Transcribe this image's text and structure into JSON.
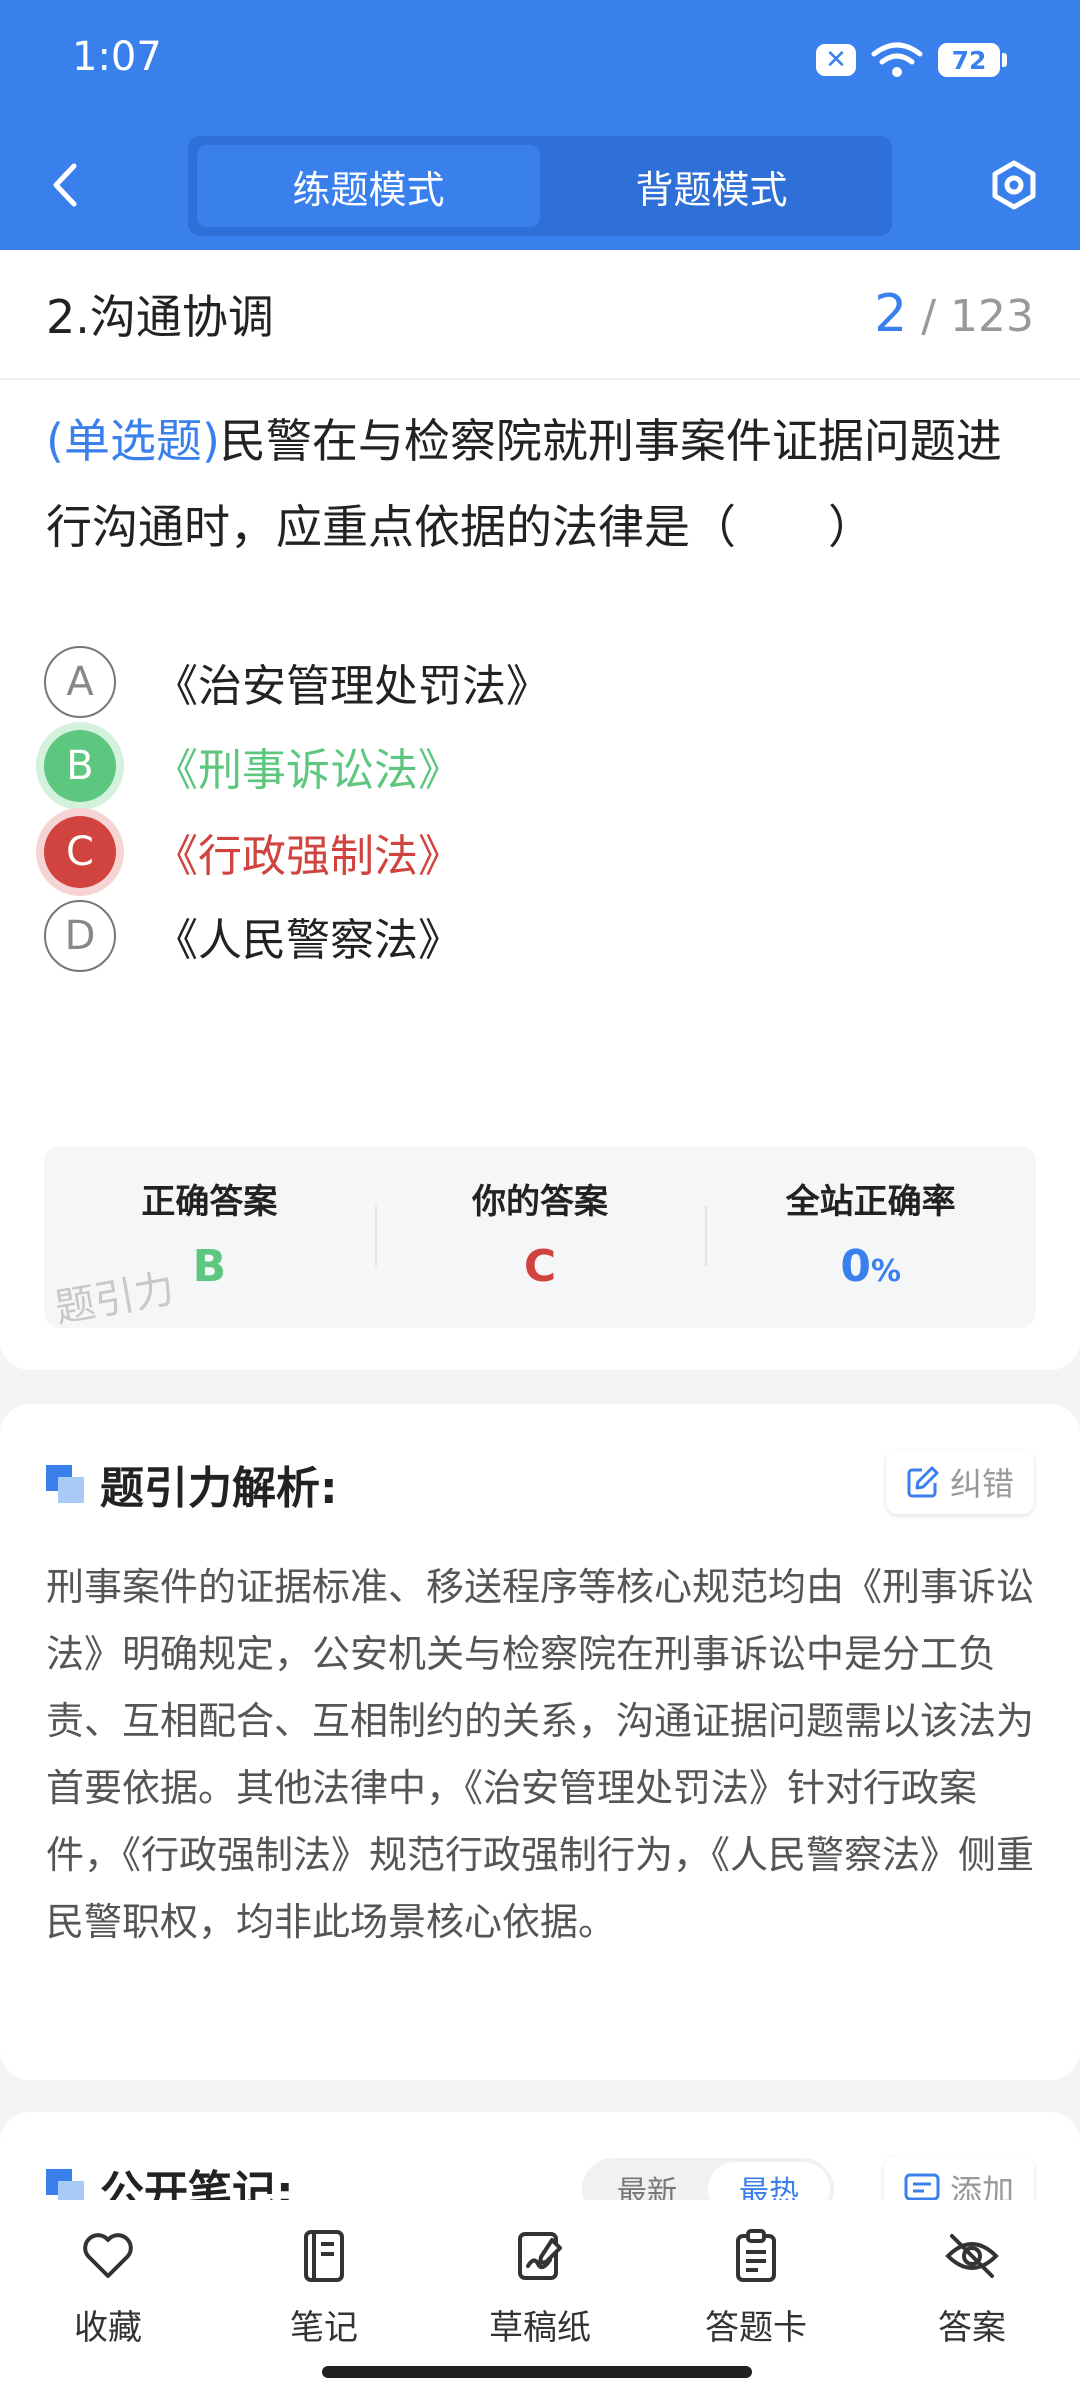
{
  "status_bar": {
    "time": "1:07",
    "battery": "72"
  },
  "header": {
    "modes": [
      {
        "label": "练题模式",
        "active": true
      },
      {
        "label": "背题模式",
        "active": false
      }
    ]
  },
  "question": {
    "category": "2.沟通协调",
    "current": "2",
    "total": "/ 123",
    "type": "(单选题)",
    "text": "民警在与检察院就刑事案件证据问题进行沟通时，应重点依据的法律是（　　）",
    "options": [
      {
        "letter": "A",
        "text": "《治安管理处罚法》",
        "state": "normal"
      },
      {
        "letter": "B",
        "text": "《刑事诉讼法》",
        "state": "correct"
      },
      {
        "letter": "C",
        "text": "《行政强制法》",
        "state": "wrong"
      },
      {
        "letter": "D",
        "text": "《人民警察法》",
        "state": "normal"
      }
    ]
  },
  "answer_summary": {
    "correct_label": "正确答案",
    "correct_value": "B",
    "yours_label": "你的答案",
    "yours_value": "C",
    "rate_label": "全站正确率",
    "rate_value": "0",
    "rate_unit": "%",
    "watermark": "题引力"
  },
  "analysis": {
    "title": "题引力解析:",
    "correct_button": "纠错",
    "text": "刑事案件的证据标准、移送程序等核心规范均由《刑事诉讼法》明确规定，公安机关与检察院在刑事诉讼中是分工负责、互相配合、互相制约的关系，沟通证据问题需以该法为首要依据。其他法律中，《治安管理处罚法》针对行政案件，《行政强制法》规范行政强制行为，《人民警察法》侧重民警职权，均非此场景核心依据。"
  },
  "notes": {
    "title": "公开笔记:",
    "sort_latest": "最新",
    "sort_hot": "最热",
    "add_button": "添加"
  },
  "bottom_nav": [
    {
      "label": "收藏",
      "icon": "heart-icon"
    },
    {
      "label": "笔记",
      "icon": "notebook-icon"
    },
    {
      "label": "草稿纸",
      "icon": "draft-paper-icon"
    },
    {
      "label": "答题卡",
      "icon": "answer-card-icon"
    },
    {
      "label": "答案",
      "icon": "eye-off-icon"
    }
  ],
  "colors": {
    "primary": "#3a80ec",
    "correct": "#5ec77f",
    "wrong": "#d0433e"
  }
}
